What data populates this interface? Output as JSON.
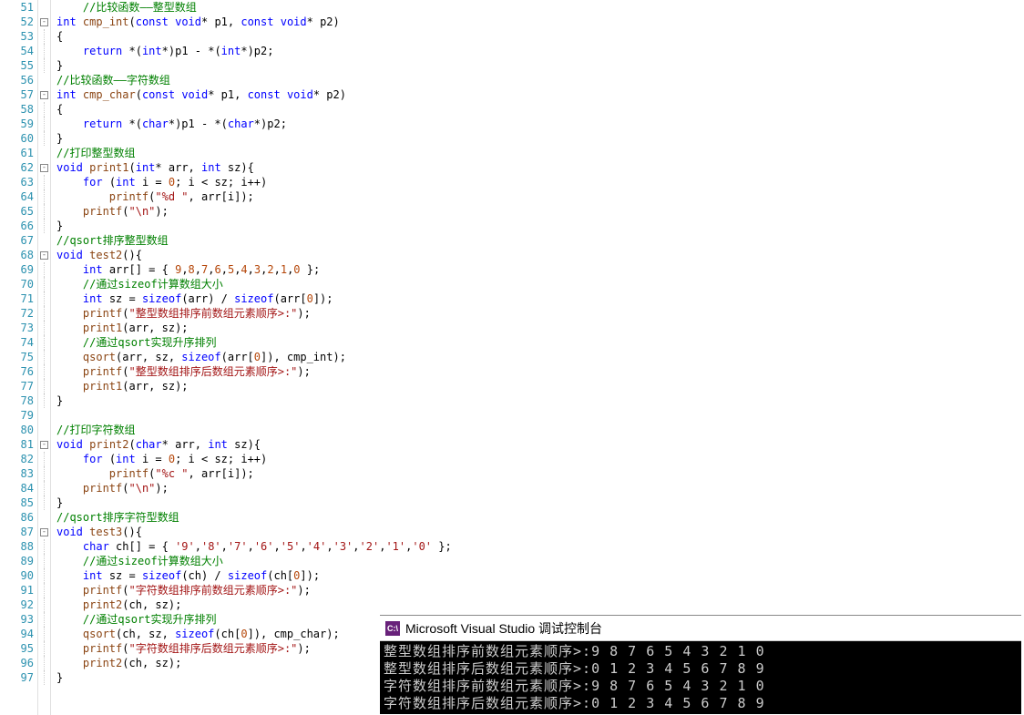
{
  "lines": [
    {
      "n": 51,
      "fold": "",
      "tokens": [
        {
          "t": "    ",
          "c": ""
        },
        {
          "t": "//比较函数——整型数组",
          "c": "cmt"
        }
      ]
    },
    {
      "n": 52,
      "fold": "box",
      "tokens": [
        {
          "t": "int",
          "c": "kw"
        },
        {
          "t": " ",
          "c": ""
        },
        {
          "t": "cmp_int",
          "c": "fn"
        },
        {
          "t": "(",
          "c": ""
        },
        {
          "t": "const",
          "c": "kw"
        },
        {
          "t": " ",
          "c": ""
        },
        {
          "t": "void",
          "c": "kw"
        },
        {
          "t": "* p1, ",
          "c": ""
        },
        {
          "t": "const",
          "c": "kw"
        },
        {
          "t": " ",
          "c": ""
        },
        {
          "t": "void",
          "c": "kw"
        },
        {
          "t": "* p2)",
          "c": ""
        }
      ]
    },
    {
      "n": 53,
      "fold": "line",
      "tokens": [
        {
          "t": "{",
          "c": ""
        }
      ]
    },
    {
      "n": 54,
      "fold": "line",
      "tokens": [
        {
          "t": "    ",
          "c": ""
        },
        {
          "t": "return",
          "c": "kw"
        },
        {
          "t": " *(",
          "c": ""
        },
        {
          "t": "int",
          "c": "kw"
        },
        {
          "t": "*)p1 - *(",
          "c": ""
        },
        {
          "t": "int",
          "c": "kw"
        },
        {
          "t": "*)p2;",
          "c": ""
        }
      ]
    },
    {
      "n": 55,
      "fold": "line",
      "tokens": [
        {
          "t": "}",
          "c": ""
        }
      ]
    },
    {
      "n": 56,
      "fold": "",
      "tokens": [
        {
          "t": "//比较函数——字符数组",
          "c": "cmt"
        }
      ]
    },
    {
      "n": 57,
      "fold": "box",
      "tokens": [
        {
          "t": "int",
          "c": "kw"
        },
        {
          "t": " ",
          "c": ""
        },
        {
          "t": "cmp_char",
          "c": "fn"
        },
        {
          "t": "(",
          "c": ""
        },
        {
          "t": "const",
          "c": "kw"
        },
        {
          "t": " ",
          "c": ""
        },
        {
          "t": "void",
          "c": "kw"
        },
        {
          "t": "* p1, ",
          "c": ""
        },
        {
          "t": "const",
          "c": "kw"
        },
        {
          "t": " ",
          "c": ""
        },
        {
          "t": "void",
          "c": "kw"
        },
        {
          "t": "* p2)",
          "c": ""
        }
      ]
    },
    {
      "n": 58,
      "fold": "line",
      "tokens": [
        {
          "t": "{",
          "c": ""
        }
      ]
    },
    {
      "n": 59,
      "fold": "line",
      "tokens": [
        {
          "t": "    ",
          "c": ""
        },
        {
          "t": "return",
          "c": "kw"
        },
        {
          "t": " *(",
          "c": ""
        },
        {
          "t": "char",
          "c": "kw"
        },
        {
          "t": "*)p1 - *(",
          "c": ""
        },
        {
          "t": "char",
          "c": "kw"
        },
        {
          "t": "*)p2;",
          "c": ""
        }
      ]
    },
    {
      "n": 60,
      "fold": "line",
      "tokens": [
        {
          "t": "}",
          "c": ""
        }
      ]
    },
    {
      "n": 61,
      "fold": "",
      "tokens": [
        {
          "t": "//打印整型数组",
          "c": "cmt"
        }
      ]
    },
    {
      "n": 62,
      "fold": "box",
      "tokens": [
        {
          "t": "void",
          "c": "kw"
        },
        {
          "t": " ",
          "c": ""
        },
        {
          "t": "print1",
          "c": "fn"
        },
        {
          "t": "(",
          "c": ""
        },
        {
          "t": "int",
          "c": "kw"
        },
        {
          "t": "* arr, ",
          "c": ""
        },
        {
          "t": "int",
          "c": "kw"
        },
        {
          "t": " sz){",
          "c": ""
        }
      ]
    },
    {
      "n": 63,
      "fold": "line",
      "tokens": [
        {
          "t": "    ",
          "c": ""
        },
        {
          "t": "for",
          "c": "kw"
        },
        {
          "t": " (",
          "c": ""
        },
        {
          "t": "int",
          "c": "kw"
        },
        {
          "t": " i = ",
          "c": ""
        },
        {
          "t": "0",
          "c": "num"
        },
        {
          "t": "; i < sz; i++)",
          "c": ""
        }
      ]
    },
    {
      "n": 64,
      "fold": "line",
      "tokens": [
        {
          "t": "        ",
          "c": ""
        },
        {
          "t": "printf",
          "c": "fn"
        },
        {
          "t": "(",
          "c": ""
        },
        {
          "t": "\"%d \"",
          "c": "str"
        },
        {
          "t": ", arr[i]);",
          "c": ""
        }
      ]
    },
    {
      "n": 65,
      "fold": "line",
      "tokens": [
        {
          "t": "    ",
          "c": ""
        },
        {
          "t": "printf",
          "c": "fn"
        },
        {
          "t": "(",
          "c": ""
        },
        {
          "t": "\"\\n\"",
          "c": "str"
        },
        {
          "t": ");",
          "c": ""
        }
      ]
    },
    {
      "n": 66,
      "fold": "line",
      "tokens": [
        {
          "t": "}",
          "c": ""
        }
      ]
    },
    {
      "n": 67,
      "fold": "",
      "tokens": [
        {
          "t": "//qsort排序整型数组",
          "c": "cmt"
        }
      ]
    },
    {
      "n": 68,
      "fold": "box",
      "tokens": [
        {
          "t": "void",
          "c": "kw"
        },
        {
          "t": " ",
          "c": ""
        },
        {
          "t": "test2",
          "c": "fn"
        },
        {
          "t": "(){",
          "c": ""
        }
      ]
    },
    {
      "n": 69,
      "fold": "line",
      "tokens": [
        {
          "t": "    ",
          "c": ""
        },
        {
          "t": "int",
          "c": "kw"
        },
        {
          "t": " arr[] = { ",
          "c": ""
        },
        {
          "t": "9",
          "c": "num"
        },
        {
          "t": ",",
          "c": ""
        },
        {
          "t": "8",
          "c": "num"
        },
        {
          "t": ",",
          "c": ""
        },
        {
          "t": "7",
          "c": "num"
        },
        {
          "t": ",",
          "c": ""
        },
        {
          "t": "6",
          "c": "num"
        },
        {
          "t": ",",
          "c": ""
        },
        {
          "t": "5",
          "c": "num"
        },
        {
          "t": ",",
          "c": ""
        },
        {
          "t": "4",
          "c": "num"
        },
        {
          "t": ",",
          "c": ""
        },
        {
          "t": "3",
          "c": "num"
        },
        {
          "t": ",",
          "c": ""
        },
        {
          "t": "2",
          "c": "num"
        },
        {
          "t": ",",
          "c": ""
        },
        {
          "t": "1",
          "c": "num"
        },
        {
          "t": ",",
          "c": ""
        },
        {
          "t": "0",
          "c": "num"
        },
        {
          "t": " };",
          "c": ""
        }
      ]
    },
    {
      "n": 70,
      "fold": "line",
      "tokens": [
        {
          "t": "    ",
          "c": ""
        },
        {
          "t": "//通过sizeof计算数组大小",
          "c": "cmt"
        }
      ]
    },
    {
      "n": 71,
      "fold": "line",
      "tokens": [
        {
          "t": "    ",
          "c": ""
        },
        {
          "t": "int",
          "c": "kw"
        },
        {
          "t": " sz = ",
          "c": ""
        },
        {
          "t": "sizeof",
          "c": "kw"
        },
        {
          "t": "(arr) / ",
          "c": ""
        },
        {
          "t": "sizeof",
          "c": "kw"
        },
        {
          "t": "(arr[",
          "c": ""
        },
        {
          "t": "0",
          "c": "num"
        },
        {
          "t": "]);",
          "c": ""
        }
      ]
    },
    {
      "n": 72,
      "fold": "line",
      "tokens": [
        {
          "t": "    ",
          "c": ""
        },
        {
          "t": "printf",
          "c": "fn"
        },
        {
          "t": "(",
          "c": ""
        },
        {
          "t": "\"整型数组排序前数组元素顺序>:\"",
          "c": "str"
        },
        {
          "t": ");",
          "c": ""
        }
      ]
    },
    {
      "n": 73,
      "fold": "line",
      "tokens": [
        {
          "t": "    ",
          "c": ""
        },
        {
          "t": "print1",
          "c": "fn"
        },
        {
          "t": "(arr, sz);",
          "c": ""
        }
      ]
    },
    {
      "n": 74,
      "fold": "line",
      "tokens": [
        {
          "t": "    ",
          "c": ""
        },
        {
          "t": "//通过qsort实现升序排列",
          "c": "cmt"
        }
      ]
    },
    {
      "n": 75,
      "fold": "line",
      "tokens": [
        {
          "t": "    ",
          "c": ""
        },
        {
          "t": "qsort",
          "c": "fn"
        },
        {
          "t": "(arr, sz, ",
          "c": ""
        },
        {
          "t": "sizeof",
          "c": "kw"
        },
        {
          "t": "(arr[",
          "c": ""
        },
        {
          "t": "0",
          "c": "num"
        },
        {
          "t": "]), cmp_int);",
          "c": ""
        }
      ]
    },
    {
      "n": 76,
      "fold": "line",
      "tokens": [
        {
          "t": "    ",
          "c": ""
        },
        {
          "t": "printf",
          "c": "fn"
        },
        {
          "t": "(",
          "c": ""
        },
        {
          "t": "\"整型数组排序后数组元素顺序>:\"",
          "c": "str"
        },
        {
          "t": ");",
          "c": ""
        }
      ]
    },
    {
      "n": 77,
      "fold": "line",
      "tokens": [
        {
          "t": "    ",
          "c": ""
        },
        {
          "t": "print1",
          "c": "fn"
        },
        {
          "t": "(arr, sz);",
          "c": ""
        }
      ]
    },
    {
      "n": 78,
      "fold": "line",
      "tokens": [
        {
          "t": "}",
          "c": ""
        }
      ]
    },
    {
      "n": 79,
      "fold": "",
      "tokens": [
        {
          "t": "",
          "c": ""
        }
      ]
    },
    {
      "n": 80,
      "fold": "",
      "tokens": [
        {
          "t": "//打印字符数组",
          "c": "cmt"
        }
      ]
    },
    {
      "n": 81,
      "fold": "box",
      "tokens": [
        {
          "t": "void",
          "c": "kw"
        },
        {
          "t": " ",
          "c": ""
        },
        {
          "t": "print2",
          "c": "fn"
        },
        {
          "t": "(",
          "c": ""
        },
        {
          "t": "char",
          "c": "kw"
        },
        {
          "t": "* arr, ",
          "c": ""
        },
        {
          "t": "int",
          "c": "kw"
        },
        {
          "t": " sz){",
          "c": ""
        }
      ]
    },
    {
      "n": 82,
      "fold": "line",
      "tokens": [
        {
          "t": "    ",
          "c": ""
        },
        {
          "t": "for",
          "c": "kw"
        },
        {
          "t": " (",
          "c": ""
        },
        {
          "t": "int",
          "c": "kw"
        },
        {
          "t": " i = ",
          "c": ""
        },
        {
          "t": "0",
          "c": "num"
        },
        {
          "t": "; i < sz; i++)",
          "c": ""
        }
      ]
    },
    {
      "n": 83,
      "fold": "line",
      "tokens": [
        {
          "t": "        ",
          "c": ""
        },
        {
          "t": "printf",
          "c": "fn"
        },
        {
          "t": "(",
          "c": ""
        },
        {
          "t": "\"%c \"",
          "c": "str"
        },
        {
          "t": ", arr[i]);",
          "c": ""
        }
      ]
    },
    {
      "n": 84,
      "fold": "line",
      "tokens": [
        {
          "t": "    ",
          "c": ""
        },
        {
          "t": "printf",
          "c": "fn"
        },
        {
          "t": "(",
          "c": ""
        },
        {
          "t": "\"\\n\"",
          "c": "str"
        },
        {
          "t": ");",
          "c": ""
        }
      ]
    },
    {
      "n": 85,
      "fold": "line",
      "tokens": [
        {
          "t": "}",
          "c": ""
        }
      ]
    },
    {
      "n": 86,
      "fold": "",
      "tokens": [
        {
          "t": "//qsort排序字符型数组",
          "c": "cmt"
        }
      ]
    },
    {
      "n": 87,
      "fold": "box",
      "tokens": [
        {
          "t": "void",
          "c": "kw"
        },
        {
          "t": " ",
          "c": ""
        },
        {
          "t": "test3",
          "c": "fn"
        },
        {
          "t": "(){",
          "c": ""
        }
      ]
    },
    {
      "n": 88,
      "fold": "line",
      "tokens": [
        {
          "t": "    ",
          "c": ""
        },
        {
          "t": "char",
          "c": "kw"
        },
        {
          "t": " ch[] = { ",
          "c": ""
        },
        {
          "t": "'9'",
          "c": "str"
        },
        {
          "t": ",",
          "c": ""
        },
        {
          "t": "'8'",
          "c": "str"
        },
        {
          "t": ",",
          "c": ""
        },
        {
          "t": "'7'",
          "c": "str"
        },
        {
          "t": ",",
          "c": ""
        },
        {
          "t": "'6'",
          "c": "str"
        },
        {
          "t": ",",
          "c": ""
        },
        {
          "t": "'5'",
          "c": "str"
        },
        {
          "t": ",",
          "c": ""
        },
        {
          "t": "'4'",
          "c": "str"
        },
        {
          "t": ",",
          "c": ""
        },
        {
          "t": "'3'",
          "c": "str"
        },
        {
          "t": ",",
          "c": ""
        },
        {
          "t": "'2'",
          "c": "str"
        },
        {
          "t": ",",
          "c": ""
        },
        {
          "t": "'1'",
          "c": "str"
        },
        {
          "t": ",",
          "c": ""
        },
        {
          "t": "'0'",
          "c": "str"
        },
        {
          "t": " };",
          "c": ""
        }
      ]
    },
    {
      "n": 89,
      "fold": "line",
      "tokens": [
        {
          "t": "    ",
          "c": ""
        },
        {
          "t": "//通过sizeof计算数组大小",
          "c": "cmt"
        }
      ]
    },
    {
      "n": 90,
      "fold": "line",
      "tokens": [
        {
          "t": "    ",
          "c": ""
        },
        {
          "t": "int",
          "c": "kw"
        },
        {
          "t": " sz = ",
          "c": ""
        },
        {
          "t": "sizeof",
          "c": "kw"
        },
        {
          "t": "(ch) / ",
          "c": ""
        },
        {
          "t": "sizeof",
          "c": "kw"
        },
        {
          "t": "(ch[",
          "c": ""
        },
        {
          "t": "0",
          "c": "num"
        },
        {
          "t": "]);",
          "c": ""
        }
      ]
    },
    {
      "n": 91,
      "fold": "line",
      "tokens": [
        {
          "t": "    ",
          "c": ""
        },
        {
          "t": "printf",
          "c": "fn"
        },
        {
          "t": "(",
          "c": ""
        },
        {
          "t": "\"字符数组排序前数组元素顺序>:\"",
          "c": "str"
        },
        {
          "t": ");",
          "c": ""
        }
      ]
    },
    {
      "n": 92,
      "fold": "line",
      "tokens": [
        {
          "t": "    ",
          "c": ""
        },
        {
          "t": "print2",
          "c": "fn"
        },
        {
          "t": "(ch, sz);",
          "c": ""
        }
      ]
    },
    {
      "n": 93,
      "fold": "line",
      "tokens": [
        {
          "t": "    ",
          "c": ""
        },
        {
          "t": "//通过qsort实现升序排列",
          "c": "cmt"
        }
      ]
    },
    {
      "n": 94,
      "fold": "line",
      "tokens": [
        {
          "t": "    ",
          "c": ""
        },
        {
          "t": "qsort",
          "c": "fn"
        },
        {
          "t": "(ch, sz, ",
          "c": ""
        },
        {
          "t": "sizeof",
          "c": "kw"
        },
        {
          "t": "(ch[",
          "c": ""
        },
        {
          "t": "0",
          "c": "num"
        },
        {
          "t": "]), cmp_char);",
          "c": ""
        }
      ]
    },
    {
      "n": 95,
      "fold": "line",
      "tokens": [
        {
          "t": "    ",
          "c": ""
        },
        {
          "t": "printf",
          "c": "fn"
        },
        {
          "t": "(",
          "c": ""
        },
        {
          "t": "\"字符数组排序后数组元素顺序>:\"",
          "c": "str"
        },
        {
          "t": ");",
          "c": ""
        }
      ]
    },
    {
      "n": 96,
      "fold": "line",
      "tokens": [
        {
          "t": "    ",
          "c": ""
        },
        {
          "t": "print2",
          "c": "fn"
        },
        {
          "t": "(ch, sz);",
          "c": ""
        }
      ]
    },
    {
      "n": 97,
      "fold": "line",
      "tokens": [
        {
          "t": "}",
          "c": ""
        }
      ]
    }
  ],
  "console": {
    "icon_text": "C:\\",
    "title": "Microsoft Visual Studio 调试控制台",
    "output": [
      "整型数组排序前数组元素顺序>:9 8 7 6 5 4 3 2 1 0",
      "整型数组排序后数组元素顺序>:0 1 2 3 4 5 6 7 8 9",
      "字符数组排序前数组元素顺序>:9 8 7 6 5 4 3 2 1 0",
      "字符数组排序后数组元素顺序>:0 1 2 3 4 5 6 7 8 9"
    ]
  }
}
